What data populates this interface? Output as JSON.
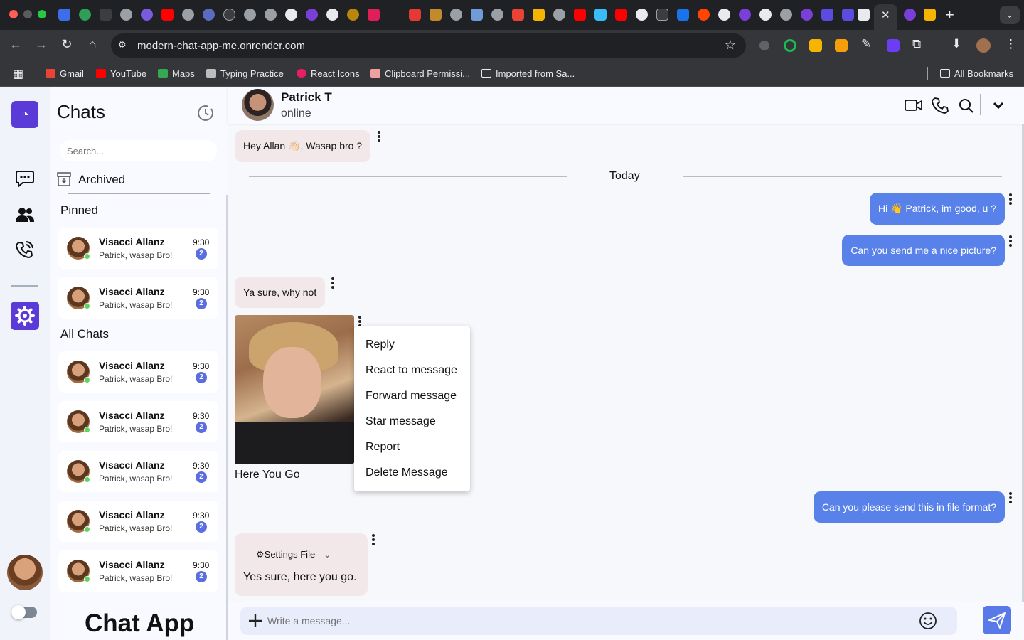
{
  "browser": {
    "url": "modern-chat-app-me.onrender.com",
    "bookmarks": [
      {
        "label": "Gmail",
        "color": "#ea4335"
      },
      {
        "label": "YouTube",
        "color": "#ff0000"
      },
      {
        "label": "Maps",
        "color": "#34a853"
      },
      {
        "label": "Typing Practice",
        "color": "#bdbdbd"
      },
      {
        "label": "React Icons",
        "color": "#e91e63"
      },
      {
        "label": "Clipboard Permissi...",
        "color": "#f0a0a0"
      },
      {
        "label": "Imported from Sa...",
        "color": "transparent"
      }
    ],
    "all_bookmarks": "All Bookmarks"
  },
  "sidebar": {
    "title": "Chats",
    "search_placeholder": "Search...",
    "archived": "Archived",
    "pinned_label": "Pinned",
    "all_label": "All Chats",
    "pinned": [
      {
        "name": "Visacci Allanz",
        "preview": "Patrick, wasap Bro!",
        "time": "9:30",
        "unread": "2"
      },
      {
        "name": "Visacci Allanz",
        "preview": "Patrick, wasap Bro!",
        "time": "9:30",
        "unread": "2"
      }
    ],
    "chats": [
      {
        "name": "Visacci Allanz",
        "preview": "Patrick, wasap Bro!",
        "time": "9:30",
        "unread": "2"
      },
      {
        "name": "Visacci Allanz",
        "preview": "Patrick, wasap Bro!",
        "time": "9:30",
        "unread": "2"
      },
      {
        "name": "Visacci Allanz",
        "preview": "Patrick, wasap Bro!",
        "time": "9:30",
        "unread": "2"
      },
      {
        "name": "Visacci Allanz",
        "preview": "Patrick, wasap Bro!",
        "time": "9:30",
        "unread": "2"
      },
      {
        "name": "Visacci Allanz",
        "preview": "Patrick, wasap Bro!",
        "time": "9:30",
        "unread": "2"
      }
    ],
    "brand": "Chat App"
  },
  "conversation": {
    "contact_name": "Patrick T",
    "contact_status": "online",
    "divider": "Today",
    "messages": {
      "m1": "Hey Allan 👋🏻, Wasap bro ?",
      "m2": "Hi 👋 Patrick, im good, u ?",
      "m3": "Can you send me a nice picture?",
      "m4": "Ya sure, why not",
      "m5_caption": "Here You Go",
      "m6": "Can you please send this in file format?",
      "m7_file": "Settings File",
      "m7_text": "Yes sure, here you go."
    },
    "context_menu": [
      "Reply",
      "React to message",
      "Forward message",
      "Star message",
      "Report",
      "Delete Message"
    ],
    "composer_placeholder": "Write a message..."
  },
  "theme": {
    "accent": "#5b3bd8",
    "outgoing_bubble": "#5981ea",
    "incoming_bubble": "#f2e8ea"
  }
}
